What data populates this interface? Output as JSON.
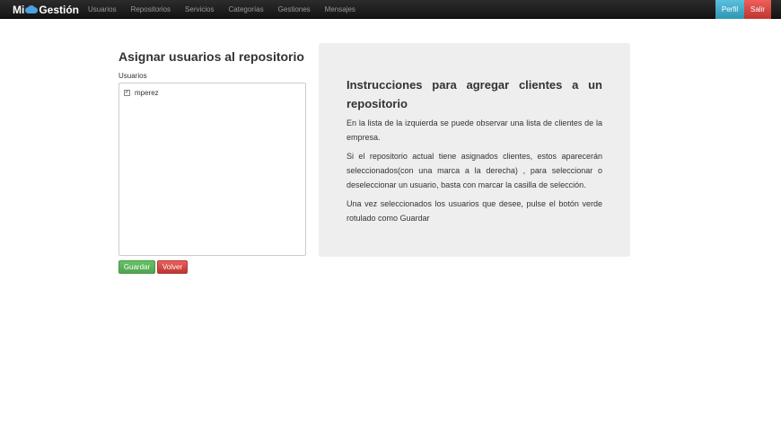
{
  "navbar": {
    "brand_part1": "Mi",
    "brand_part2": "Gestión",
    "items": [
      "Usuarios",
      "Repositorios",
      "Servicios",
      "Categorías",
      "Gestiones",
      "Mensajes"
    ],
    "perfil_label": "Perfil",
    "salir_label": "Salir"
  },
  "main": {
    "title": "Asignar usuarios al repositorio",
    "users_label": "Usuarios",
    "users": [
      {
        "name": "mperez",
        "checked": true
      }
    ],
    "save_label": "Guardar",
    "back_label": "Volver"
  },
  "instructions": {
    "title": "Instrucciones para agregar clientes a un repositorio",
    "paragraphs": [
      "En la lista de la izquierda se puede observar una lista de clientes de la empresa.",
      "Si el repositorio actual tiene asignados clientes, estos aparecerán seleccionados(con una marca a la derecha) , para seleccionar o deseleccionar un usuario, basta con marcar la casilla de selección.",
      "Una vez seleccionados los usuarios que desee, pulse el botón verde rotulado como Guardar"
    ]
  },
  "colors": {
    "navbar_bg": "#1b1b1b",
    "perfil_bg": "#49afcd",
    "salir_bg": "#da4f49",
    "guardar_bg": "#5bb75b",
    "volver_bg": "#da4f49",
    "panel_bg": "#eeeeee"
  }
}
